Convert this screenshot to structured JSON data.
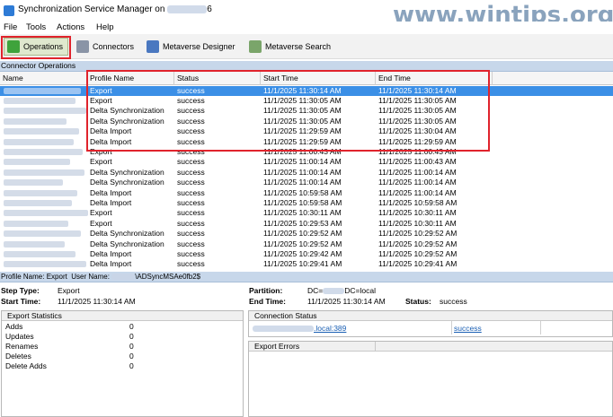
{
  "window": {
    "title": "Synchronization Service Manager on",
    "title_suffix": "6"
  },
  "watermark": "www.wintips.org",
  "menu": [
    "File",
    "Tools",
    "Actions",
    "Help"
  ],
  "toolbar": [
    {
      "label": "Operations",
      "icon": "operations-icon"
    },
    {
      "label": "Connectors",
      "icon": "connectors-icon"
    },
    {
      "label": "Metaverse Designer",
      "icon": "metaverse-designer-icon"
    },
    {
      "label": "Metaverse Search",
      "icon": "metaverse-search-icon"
    }
  ],
  "connector_operations": {
    "title": "Connector Operations",
    "columns": [
      "Name",
      "Profile Name",
      "Status",
      "Start Time",
      "End Time"
    ],
    "rows": [
      {
        "profile": "Export",
        "status": "success",
        "start": "11/1/2025 11:30:14 AM",
        "end": "11/1/2025 11:30:14 AM"
      },
      {
        "profile": "Export",
        "status": "success",
        "start": "11/1/2025 11:30:05 AM",
        "end": "11/1/2025 11:30:05 AM"
      },
      {
        "profile": "Delta Synchronization",
        "status": "success",
        "start": "11/1/2025 11:30:05 AM",
        "end": "11/1/2025 11:30:05 AM"
      },
      {
        "profile": "Delta Synchronization",
        "status": "success",
        "start": "11/1/2025 11:30:05 AM",
        "end": "11/1/2025 11:30:05 AM"
      },
      {
        "profile": "Delta Import",
        "status": "success",
        "start": "11/1/2025 11:29:59 AM",
        "end": "11/1/2025 11:30:04 AM"
      },
      {
        "profile": "Delta Import",
        "status": "success",
        "start": "11/1/2025 11:29:59 AM",
        "end": "11/1/2025 11:29:59 AM"
      },
      {
        "profile": "Export",
        "status": "success",
        "start": "11/1/2025 11:00:43 AM",
        "end": "11/1/2025 11:00:43 AM"
      },
      {
        "profile": "Export",
        "status": "success",
        "start": "11/1/2025 11:00:14 AM",
        "end": "11/1/2025 11:00:43 AM"
      },
      {
        "profile": "Delta Synchronization",
        "status": "success",
        "start": "11/1/2025 11:00:14 AM",
        "end": "11/1/2025 11:00:14 AM"
      },
      {
        "profile": "Delta Synchronization",
        "status": "success",
        "start": "11/1/2025 11:00:14 AM",
        "end": "11/1/2025 11:00:14 AM"
      },
      {
        "profile": "Delta Import",
        "status": "success",
        "start": "11/1/2025 10:59:58 AM",
        "end": "11/1/2025 11:00:14 AM"
      },
      {
        "profile": "Delta Import",
        "status": "success",
        "start": "11/1/2025 10:59:58 AM",
        "end": "11/1/2025 10:59:58 AM"
      },
      {
        "profile": "Export",
        "status": "success",
        "start": "11/1/2025 10:30:11 AM",
        "end": "11/1/2025 10:30:11 AM"
      },
      {
        "profile": "Export",
        "status": "success",
        "start": "11/1/2025 10:29:53 AM",
        "end": "11/1/2025 10:30:11 AM"
      },
      {
        "profile": "Delta Synchronization",
        "status": "success",
        "start": "11/1/2025 10:29:52 AM",
        "end": "11/1/2025 10:29:52 AM"
      },
      {
        "profile": "Delta Synchronization",
        "status": "success",
        "start": "11/1/2025 10:29:52 AM",
        "end": "11/1/2025 10:29:52 AM"
      },
      {
        "profile": "Delta Import",
        "status": "success",
        "start": "11/1/2025 10:29:42 AM",
        "end": "11/1/2025 10:29:52 AM"
      },
      {
        "profile": "Delta Import",
        "status": "success",
        "start": "11/1/2025 10:29:41 AM",
        "end": "11/1/2025 10:29:41 AM"
      }
    ]
  },
  "details": {
    "profile_bar": {
      "label": "Profile Name:",
      "profile": "Export",
      "user_label": "User Name:",
      "user_value": "\\ADSyncMSAe0fb2$"
    },
    "step_type_label": "Step Type:",
    "step_type": "Export",
    "start_time_label": "Start Time:",
    "start_time": "11/1/2025 11:30:14 AM",
    "partition_label": "Partition:",
    "partition_prefix": "DC=",
    "partition_suffix": "DC=local",
    "end_time_label": "End Time:",
    "end_time": "11/1/2025 11:30:14 AM",
    "status_label": "Status:",
    "status": "success"
  },
  "export_statistics": {
    "title": "Export Statistics",
    "items": [
      {
        "label": "Adds",
        "value": "0"
      },
      {
        "label": "Updates",
        "value": "0"
      },
      {
        "label": "Renames",
        "value": "0"
      },
      {
        "label": "Deletes",
        "value": "0"
      },
      {
        "label": "Delete Adds",
        "value": "0"
      }
    ]
  },
  "connection_status": {
    "title": "Connection Status",
    "server_suffix": ".local:389",
    "result": "success"
  },
  "export_errors": {
    "title": "Export Errors"
  }
}
